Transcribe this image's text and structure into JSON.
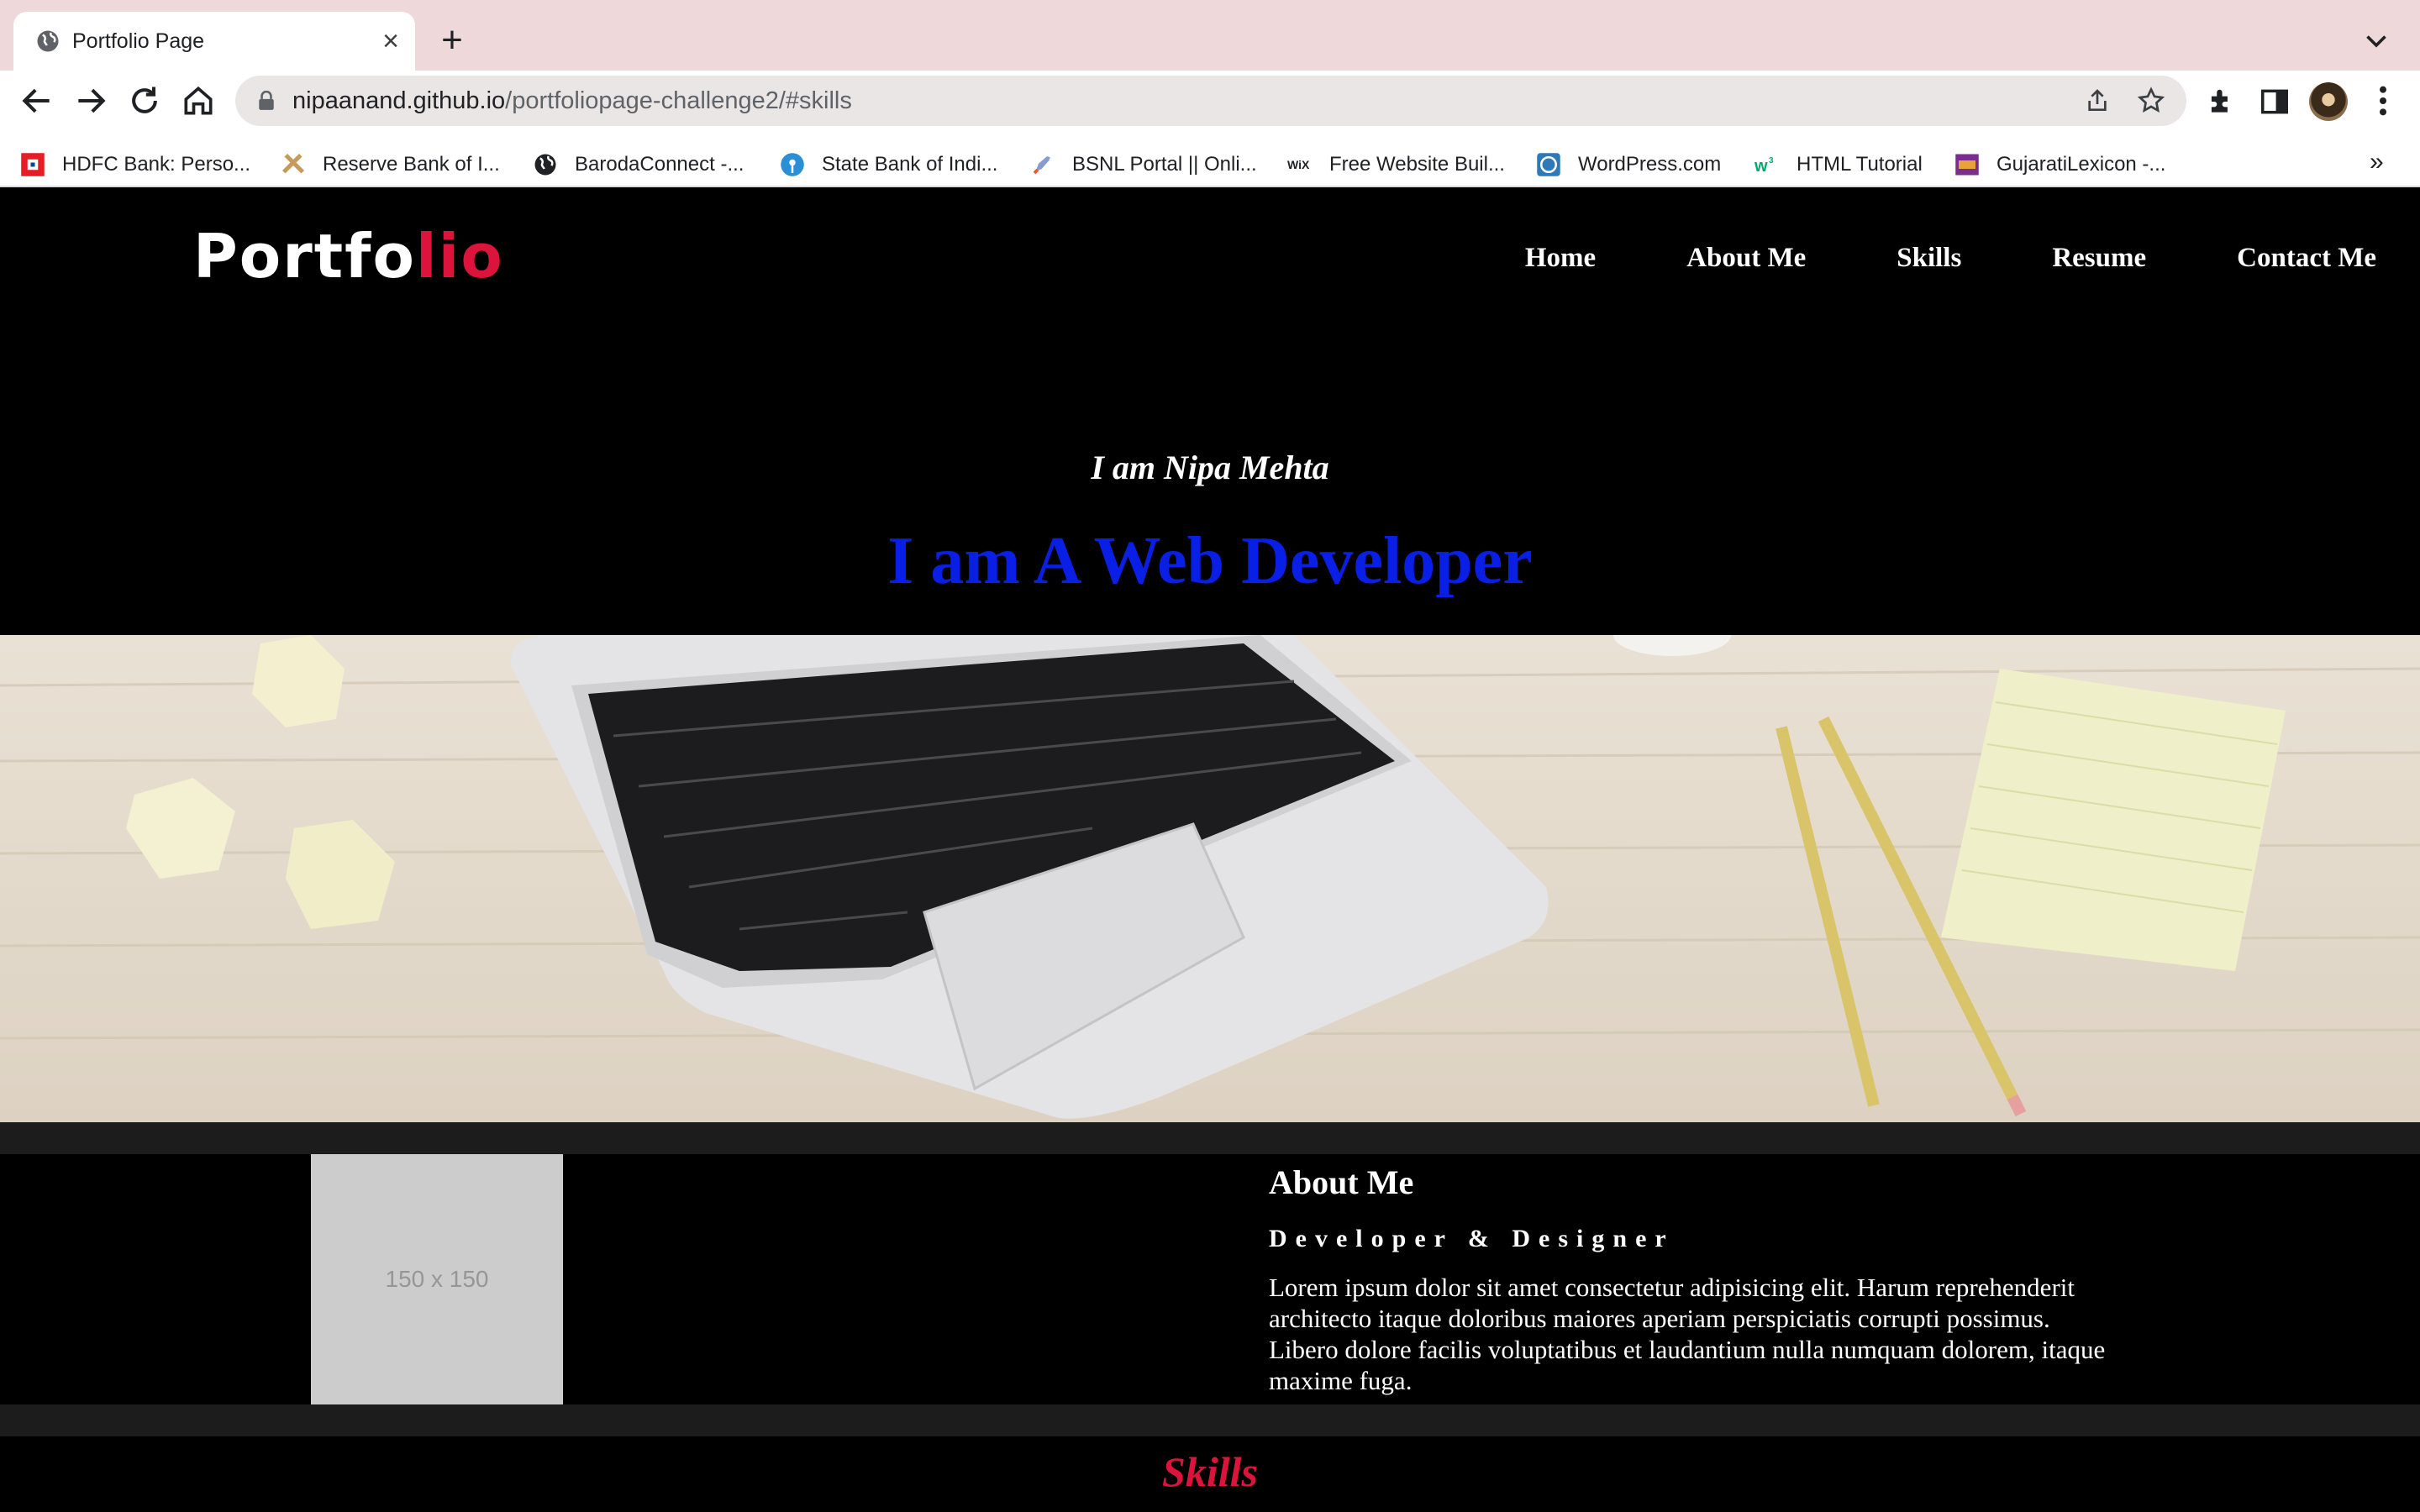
{
  "browser": {
    "tab_title": "Portfolio Page",
    "url_host": "nipaanand.github.io",
    "url_path": "/portfoliopage-challenge2/#skills",
    "bookmarks": [
      {
        "label": "HDFC Bank: Perso..."
      },
      {
        "label": "Reserve Bank of I..."
      },
      {
        "label": "BarodaConnect -..."
      },
      {
        "label": "State Bank of Indi..."
      },
      {
        "label": "BSNL Portal || Onli..."
      },
      {
        "label": "Free Website Buil..."
      },
      {
        "label": "WordPress.com"
      },
      {
        "label": "HTML Tutorial"
      },
      {
        "label": "GujaratiLexicon -..."
      }
    ],
    "bookmarks_overflow": "»"
  },
  "site": {
    "logo_main": "Portfo",
    "logo_accent": "lio",
    "nav": [
      "Home",
      "About Me",
      "Skills",
      "Resume",
      "Contact Me"
    ],
    "intro": "I am Nipa Mehta",
    "headline": "I am A Web Developer",
    "about": {
      "image_placeholder": "150 x 150",
      "title": "About Me",
      "subtitle": "Developer & Designer",
      "text": "Lorem ipsum dolor sit amet consectetur adipisicing elit. Harum reprehenderit architecto itaque doloribus maiores aperiam perspiciatis corrupti possimus. Libero dolore facilis voluptatibus et laudantium nulla numquam dolorem, itaque maxime fuga."
    },
    "skills_heading": "Skills"
  },
  "colors": {
    "accent": "#dc143c",
    "headline": "#0a1fe6",
    "page_bg": "#000000",
    "tabstrip_bg": "#eed8d9"
  }
}
